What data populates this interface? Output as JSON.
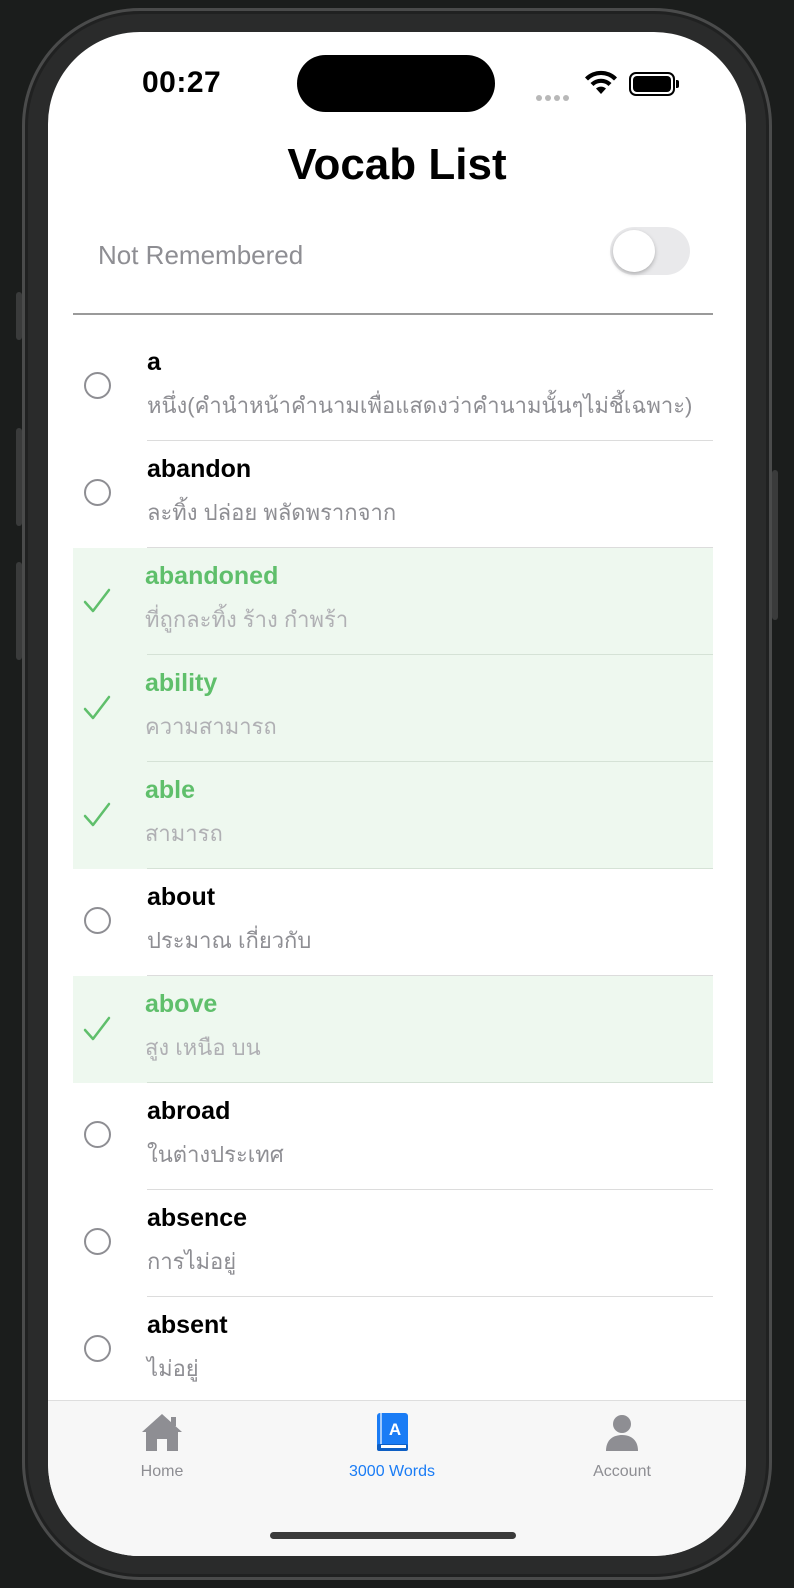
{
  "status_bar": {
    "time": "00:27"
  },
  "header": {
    "title": "Vocab List"
  },
  "filter": {
    "label": "Not Remembered",
    "toggle_on": false
  },
  "colors": {
    "accent_blue": "#1a7cf5",
    "remembered_green": "#5fbf6b",
    "remembered_bg": "#eef8ef"
  },
  "vocab": [
    {
      "word": "a",
      "meaning": "หนึ่ง(คำนำหน้าคำนามเพื่อแสดงว่าคำนามนั้นๆไม่ชี้เฉพาะ)",
      "remembered": false
    },
    {
      "word": "abandon",
      "meaning": "ละทิ้ง ปล่อย พลัดพรากจาก",
      "remembered": false
    },
    {
      "word": "abandoned",
      "meaning": "ที่ถูกละทิ้ง ร้าง กำพร้า",
      "remembered": true
    },
    {
      "word": "ability",
      "meaning": "ความสามารถ",
      "remembered": true
    },
    {
      "word": "able",
      "meaning": "สามารถ",
      "remembered": true
    },
    {
      "word": "about",
      "meaning": "ประมาณ เกี่ยวกับ",
      "remembered": false
    },
    {
      "word": "above",
      "meaning": "สูง เหนือ บน",
      "remembered": true
    },
    {
      "word": "abroad",
      "meaning": "ในต่างประเทศ",
      "remembered": false
    },
    {
      "word": "absence",
      "meaning": "การไม่อยู่",
      "remembered": false
    },
    {
      "word": "absent",
      "meaning": "ไม่อยู่",
      "remembered": false
    }
  ],
  "tabs": [
    {
      "label": "Home",
      "icon": "house-icon",
      "active": false
    },
    {
      "label": "3000 Words",
      "icon": "book-icon",
      "active": true
    },
    {
      "label": "Account",
      "icon": "person-icon",
      "active": false
    }
  ]
}
